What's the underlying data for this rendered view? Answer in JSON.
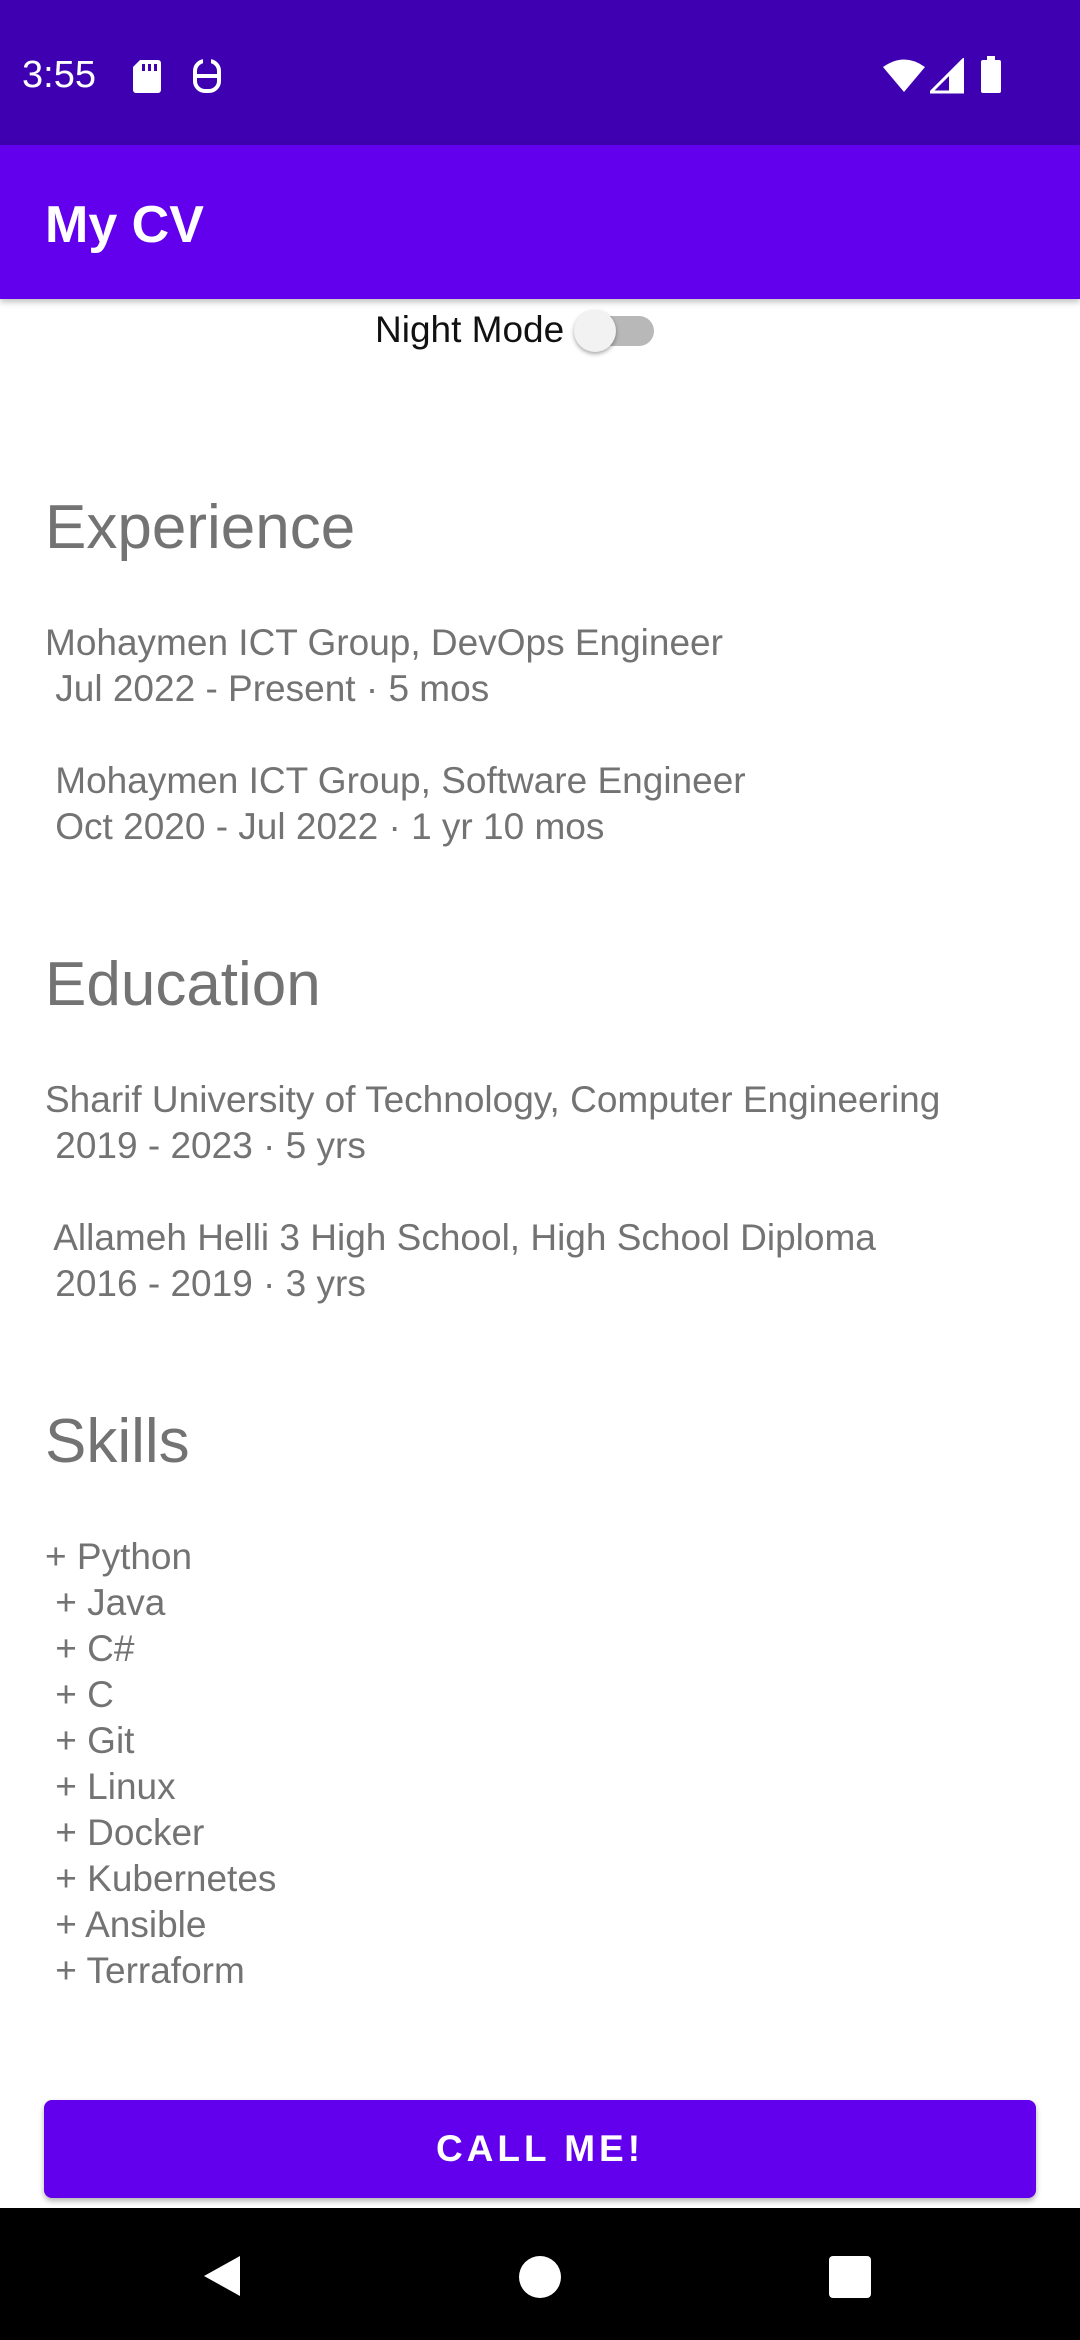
{
  "status_bar": {
    "time": "3:55",
    "icons": [
      "sd-card-icon",
      "sync-icon",
      "wifi-icon",
      "signal-icon",
      "battery-icon"
    ]
  },
  "app_bar": {
    "title": "My CV"
  },
  "night_mode": {
    "label": "Night Mode",
    "enabled": false
  },
  "experience": {
    "heading": "Experience",
    "lines": [
      "Mohaymen ICT Group, DevOps Engineer",
      " Jul 2022 - Present · 5 mos",
      " Mohaymen ICT Group, Software Engineer",
      " Oct 2020 - Jul 2022 · 1 yr 10 mos"
    ]
  },
  "education": {
    "heading": "Education",
    "lines": [
      "Sharif University of Technology, Computer Engineering",
      " 2019 - 2023 · 5 yrs",
      " Allameh Helli 3 High School, High School Diploma",
      " 2016 - 2019 · 3 yrs"
    ]
  },
  "skills": {
    "heading": "Skills",
    "lines": [
      "+ Python",
      " + Java",
      " + C#",
      " + C",
      " + Git",
      " + Linux",
      " + Docker",
      " + Kubernetes",
      " + Ansible",
      " + Terraform"
    ]
  },
  "call_button": {
    "label": "CALL ME!"
  },
  "colors": {
    "status_bar": "#3e00b0",
    "primary": "#6200ee",
    "text_secondary": "#737373"
  },
  "nav_bar": {
    "icons": [
      "back-icon",
      "home-icon",
      "recents-icon"
    ]
  }
}
